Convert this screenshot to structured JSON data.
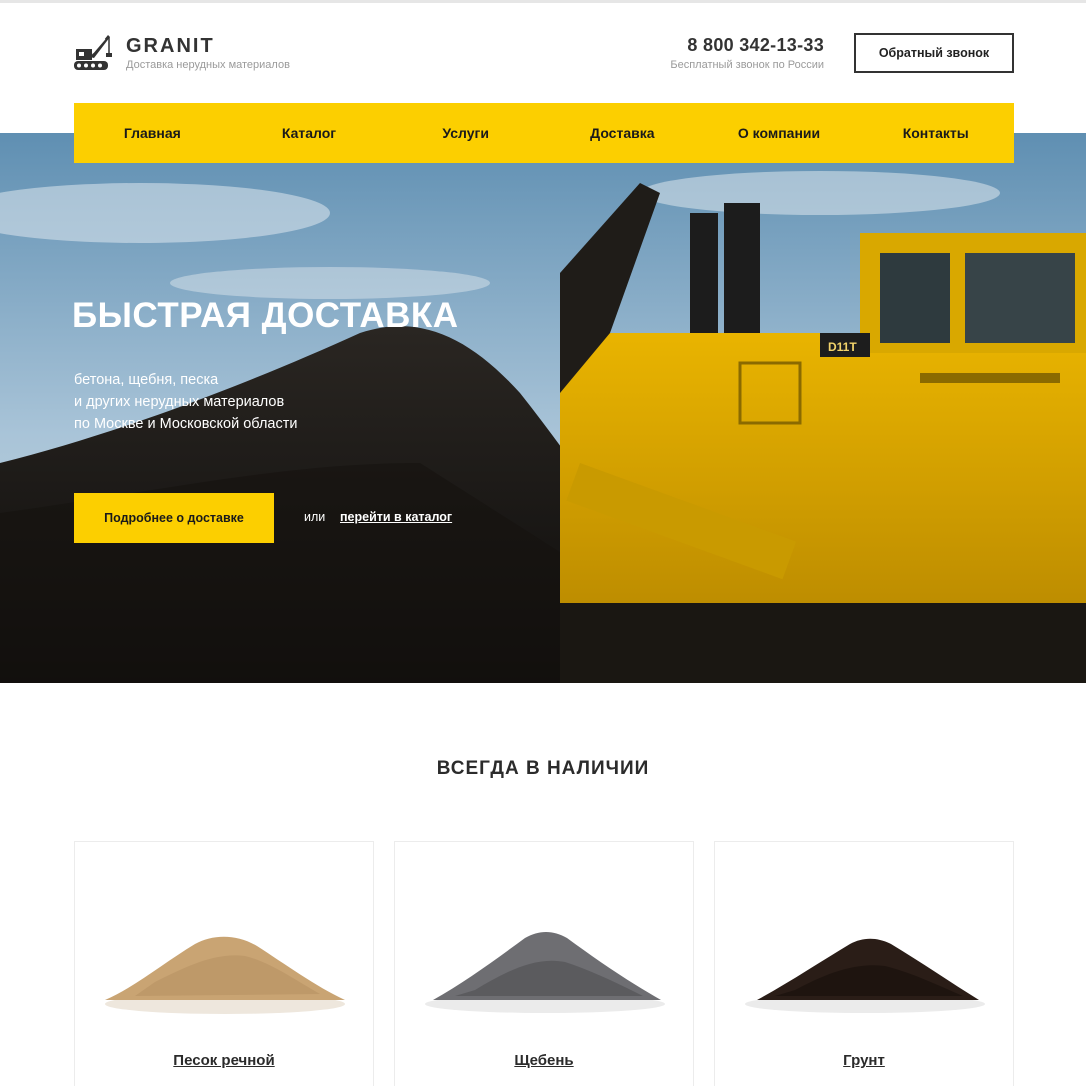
{
  "header": {
    "brand_name": "GRANIT",
    "tagline": "Доставка нерудных материалов",
    "phone": "8 800 342-13-33",
    "phone_note": "Бесплатный звонок по России",
    "callback_label": "Обратный звонок"
  },
  "nav": {
    "items": [
      {
        "label": "Главная"
      },
      {
        "label": "Каталог"
      },
      {
        "label": "Услуги"
      },
      {
        "label": "Доставка"
      },
      {
        "label": "О компании"
      },
      {
        "label": "Контакты"
      }
    ]
  },
  "hero": {
    "title": "БЫСТРАЯ ДОСТАВКА",
    "text_lines": [
      "бетона, щебня, песка",
      "и других нерудных материалов",
      "по Москве и Московской области"
    ],
    "button_label": "Подробнее о доставке",
    "or_text": "или",
    "link_label": "перейти в каталог",
    "image_icon": "bulldozer-photo"
  },
  "products": {
    "title": "ВСЕГДА В НАЛИЧИИ",
    "items": [
      {
        "label": "Песок речной",
        "color": "#c9a473"
      },
      {
        "label": "Щебень",
        "color": "#6e6e72"
      },
      {
        "label": "Грунт",
        "color": "#2a1d17"
      }
    ]
  },
  "colors": {
    "accent": "#fccf00",
    "text": "#2b2b2b",
    "muted": "#9a9a9a"
  }
}
